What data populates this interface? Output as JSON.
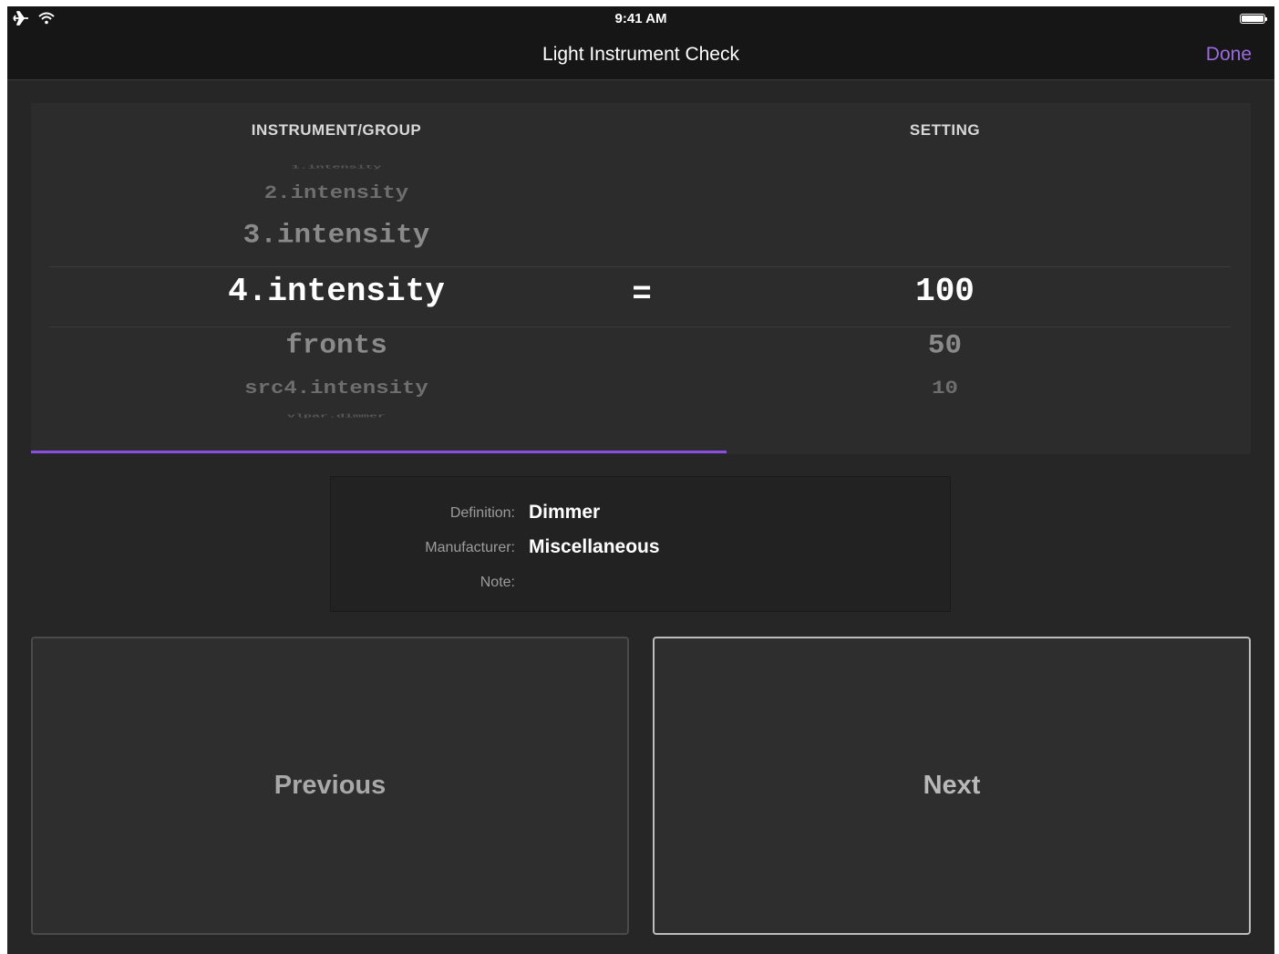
{
  "status_bar": {
    "time": "9:41 AM",
    "icons": [
      "airplane-icon",
      "wifi-icon",
      "battery-icon"
    ]
  },
  "nav": {
    "title": "Light Instrument Check",
    "done_label": "Done"
  },
  "picker": {
    "instrument_header": "INSTRUMENT/GROUP",
    "setting_header": "SETTING",
    "equals": "=",
    "instrument_items": [
      "1.intensity",
      "2.intensity",
      "3.intensity",
      "4.intensity",
      "fronts",
      "src4.intensity",
      "vlpar.dimmer"
    ],
    "selected_instrument": "4.intensity",
    "setting_items": [
      "100",
      "50",
      "10"
    ],
    "selected_setting": "100",
    "progress_fraction": 0.57
  },
  "info": {
    "definition_label": "Definition:",
    "definition_value": "Dimmer",
    "manufacturer_label": "Manufacturer:",
    "manufacturer_value": "Miscellaneous",
    "note_label": "Note:",
    "note_value": ""
  },
  "buttons": {
    "previous_label": "Previous",
    "next_label": "Next"
  },
  "colors": {
    "accent": "#9b6be0",
    "progress": "#8a4fe0",
    "background": "#262626"
  }
}
